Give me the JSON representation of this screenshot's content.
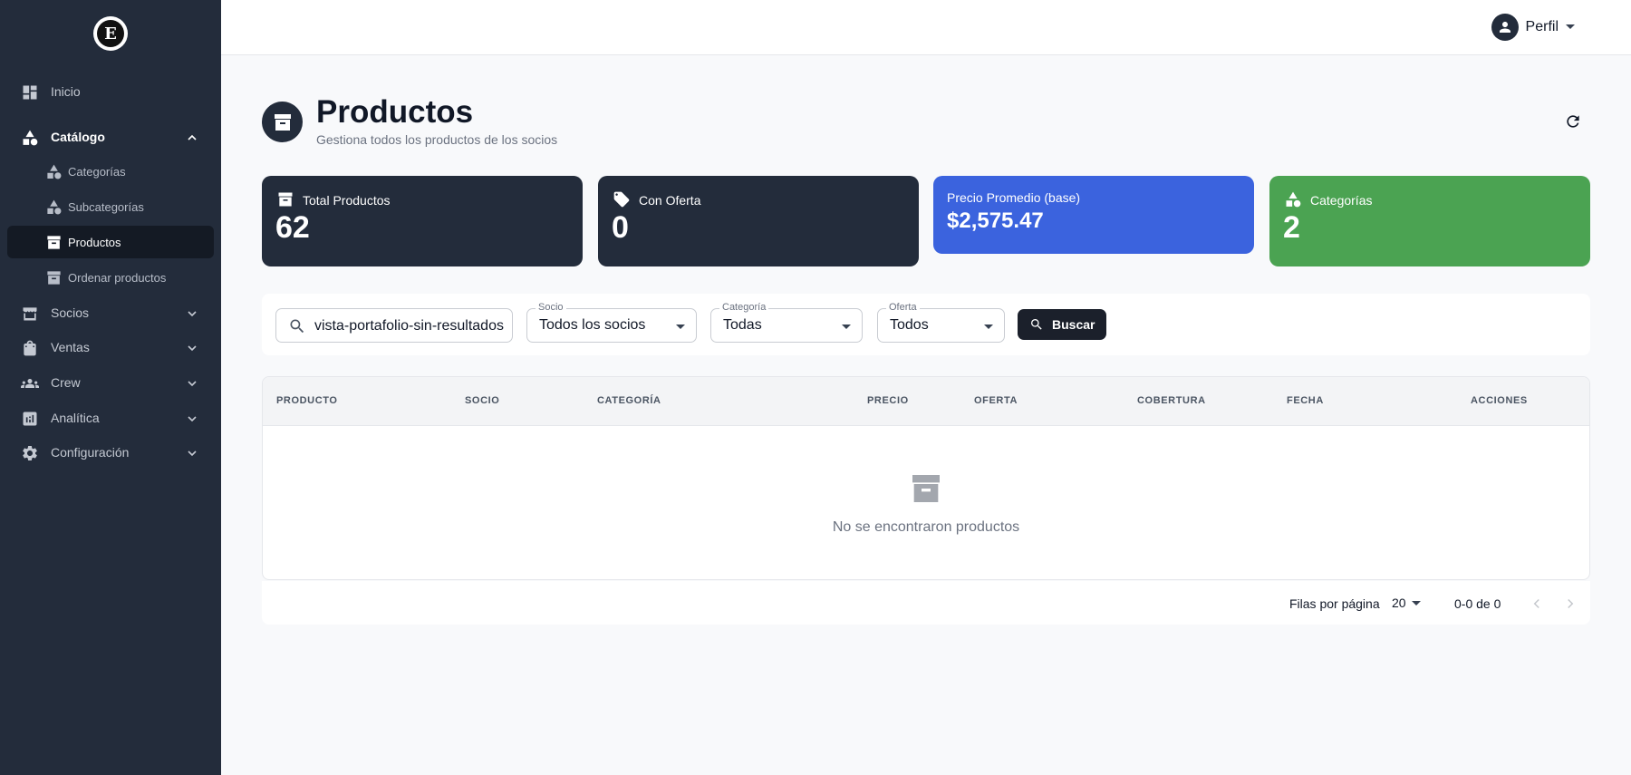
{
  "sidebar": {
    "logo_letter": "E",
    "items": [
      {
        "label": "Inicio",
        "icon": "dashboard-icon"
      },
      {
        "label": "Catálogo",
        "icon": "shapes-icon",
        "expanded": true
      },
      {
        "label": "Socios",
        "icon": "store-icon"
      },
      {
        "label": "Ventas",
        "icon": "shopping-bag-icon"
      },
      {
        "label": "Crew",
        "icon": "group-icon"
      },
      {
        "label": "Analítica",
        "icon": "analytics-icon"
      },
      {
        "label": "Configuración",
        "icon": "gear-icon"
      }
    ],
    "catalog_sub": [
      {
        "label": "Categorías",
        "icon": "shapes-icon"
      },
      {
        "label": "Subcategorías",
        "icon": "shapes-icon"
      },
      {
        "label": "Productos",
        "icon": "archive-icon",
        "active": true
      },
      {
        "label": "Ordenar productos",
        "icon": "archive-icon"
      }
    ]
  },
  "topbar": {
    "profile_label": "Perfil"
  },
  "header": {
    "title": "Productos",
    "subtitle": "Gestiona todos los productos de los socios"
  },
  "stats": [
    {
      "label": "Total Productos",
      "value": "62",
      "color": "#232c3b",
      "icon": "archive-icon"
    },
    {
      "label": "Con Oferta",
      "value": "0",
      "color": "#232c3b",
      "icon": "tag-icon"
    },
    {
      "label": "Precio Promedio (base)",
      "value": "$2,575.47",
      "color": "#3b63de"
    },
    {
      "label": "Categorías",
      "value": "2",
      "color": "#4ba352",
      "icon": "shapes-icon"
    }
  ],
  "filters": {
    "search_value": "vista-portafolio-sin-resultados",
    "socio_legend": "Socio",
    "socio_value": "Todos los socios",
    "categoria_legend": "Categoría",
    "categoria_value": "Todas",
    "oferta_legend": "Oferta",
    "oferta_value": "Todos",
    "search_button": "Buscar"
  },
  "table": {
    "columns": [
      "PRODUCTO",
      "SOCIO",
      "CATEGORÍA",
      "PRECIO",
      "OFERTA",
      "COBERTURA",
      "FECHA",
      "ACCIONES"
    ],
    "empty_message": "No se encontraron productos"
  },
  "pagination": {
    "rows_label": "Filas por página",
    "rows_value": "20",
    "range": "0-0 de 0"
  }
}
